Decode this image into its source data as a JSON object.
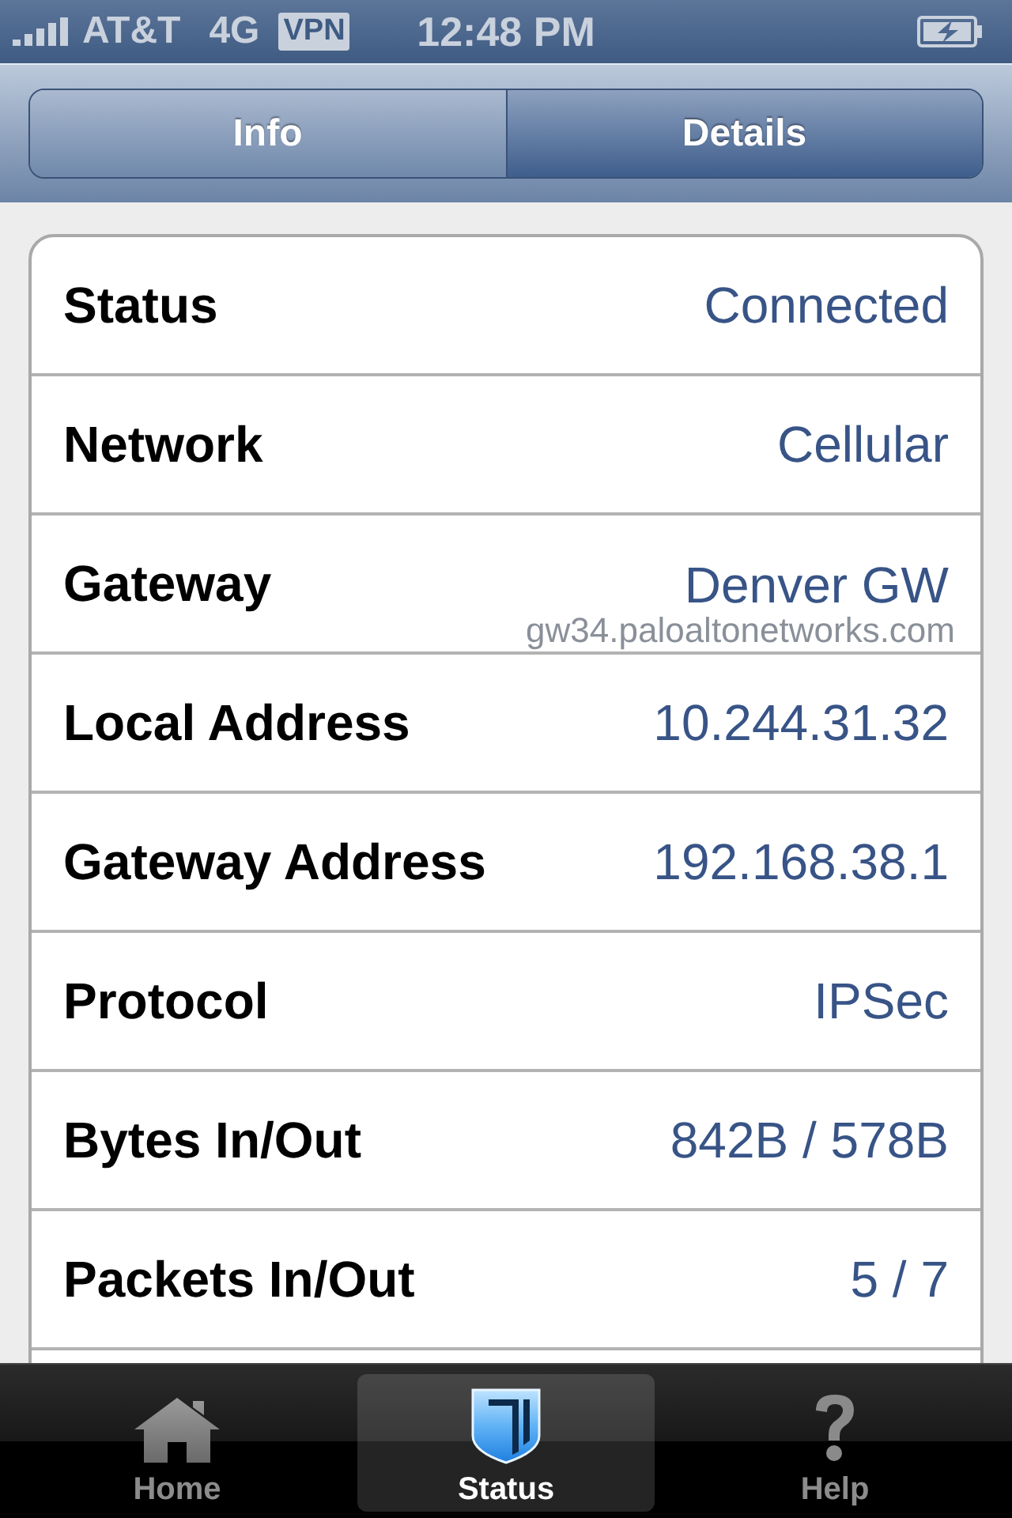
{
  "status_bar": {
    "carrier": "AT&T",
    "network": "4G",
    "vpn": "VPN",
    "time": "12:48 PM"
  },
  "segments": [
    {
      "label": "Info",
      "selected": false
    },
    {
      "label": "Details",
      "selected": true
    }
  ],
  "rows": [
    {
      "label": "Status",
      "value": "Connected"
    },
    {
      "label": "Network",
      "value": "Cellular"
    },
    {
      "label": "Gateway",
      "value": "Denver GW",
      "detail": "gw34.paloaltonetworks.com"
    },
    {
      "label": "Local Address",
      "value": "10.244.31.32"
    },
    {
      "label": "Gateway Address",
      "value": "192.168.38.1"
    },
    {
      "label": "Protocol",
      "value": "IPSec"
    },
    {
      "label": "Bytes In/Out",
      "value": "842B / 578B"
    },
    {
      "label": "Packets In/Out",
      "value": "5 / 7"
    }
  ],
  "tab_bar": [
    {
      "label": "Home",
      "kind": "home",
      "selected": false
    },
    {
      "label": "Status",
      "kind": "shield",
      "selected": true
    },
    {
      "label": "Help",
      "kind": "help",
      "selected": false
    }
  ]
}
